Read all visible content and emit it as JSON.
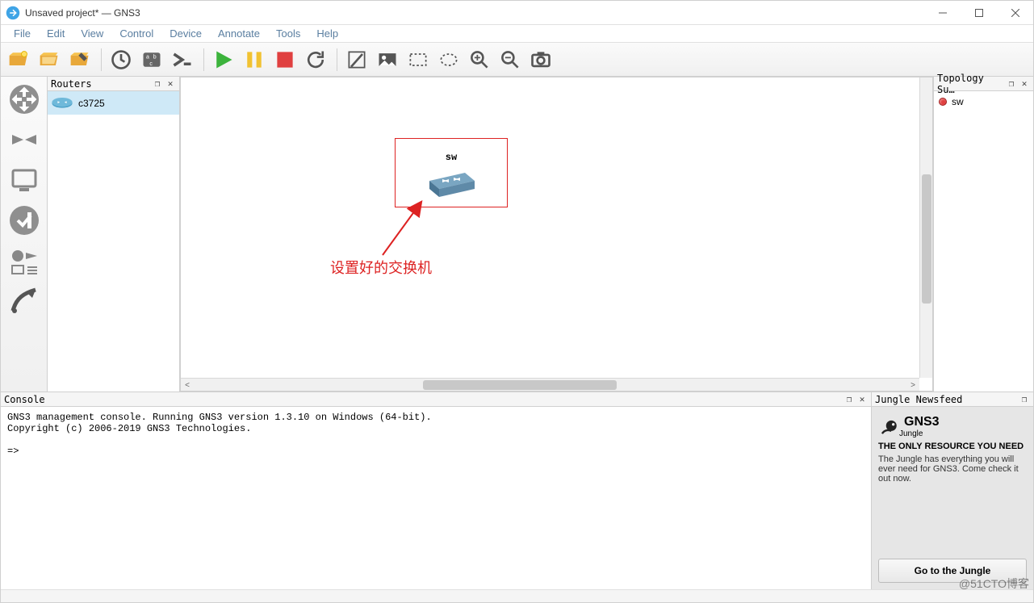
{
  "window": {
    "title": "Unsaved project* — GNS3"
  },
  "menu": {
    "items": [
      "File",
      "Edit",
      "View",
      "Control",
      "Device",
      "Annotate",
      "Tools",
      "Help"
    ]
  },
  "toolbar_icons": [
    "new-project-icon",
    "open-project-icon",
    "save-project-icon",
    "sep",
    "snapshot-icon",
    "show-names-icon",
    "console-icon",
    "sep",
    "start-icon",
    "pause-icon",
    "stop-icon",
    "reload-icon",
    "sep",
    "note-icon",
    "image-icon",
    "rect-icon",
    "ellipse-icon",
    "zoom-in-icon",
    "zoom-out-icon",
    "screenshot-icon"
  ],
  "routers_panel": {
    "title": "Routers",
    "items": [
      {
        "name": "c3725"
      }
    ]
  },
  "canvas": {
    "selected_node_label": "sw",
    "annotation_text": "设置好的交换机"
  },
  "topology_panel": {
    "title": "Topology Su…",
    "items": [
      {
        "name": "sw",
        "status": "stopped"
      }
    ]
  },
  "console": {
    "title": "Console",
    "line1": "GNS3 management console. Running GNS3 version 1.3.10 on Windows (64-bit).",
    "line2": "Copyright (c) 2006-2019 GNS3 Technologies.",
    "prompt": "=>"
  },
  "jungle": {
    "title": "Jungle Newsfeed",
    "brand": "GNS3",
    "sub": "Jungle",
    "headline": "THE ONLY RESOURCE YOU NEED",
    "desc": "The Jungle has everything you will ever need for GNS3. Come check it out now.",
    "button": "Go to the Jungle"
  },
  "watermark": "@51CTO博客"
}
